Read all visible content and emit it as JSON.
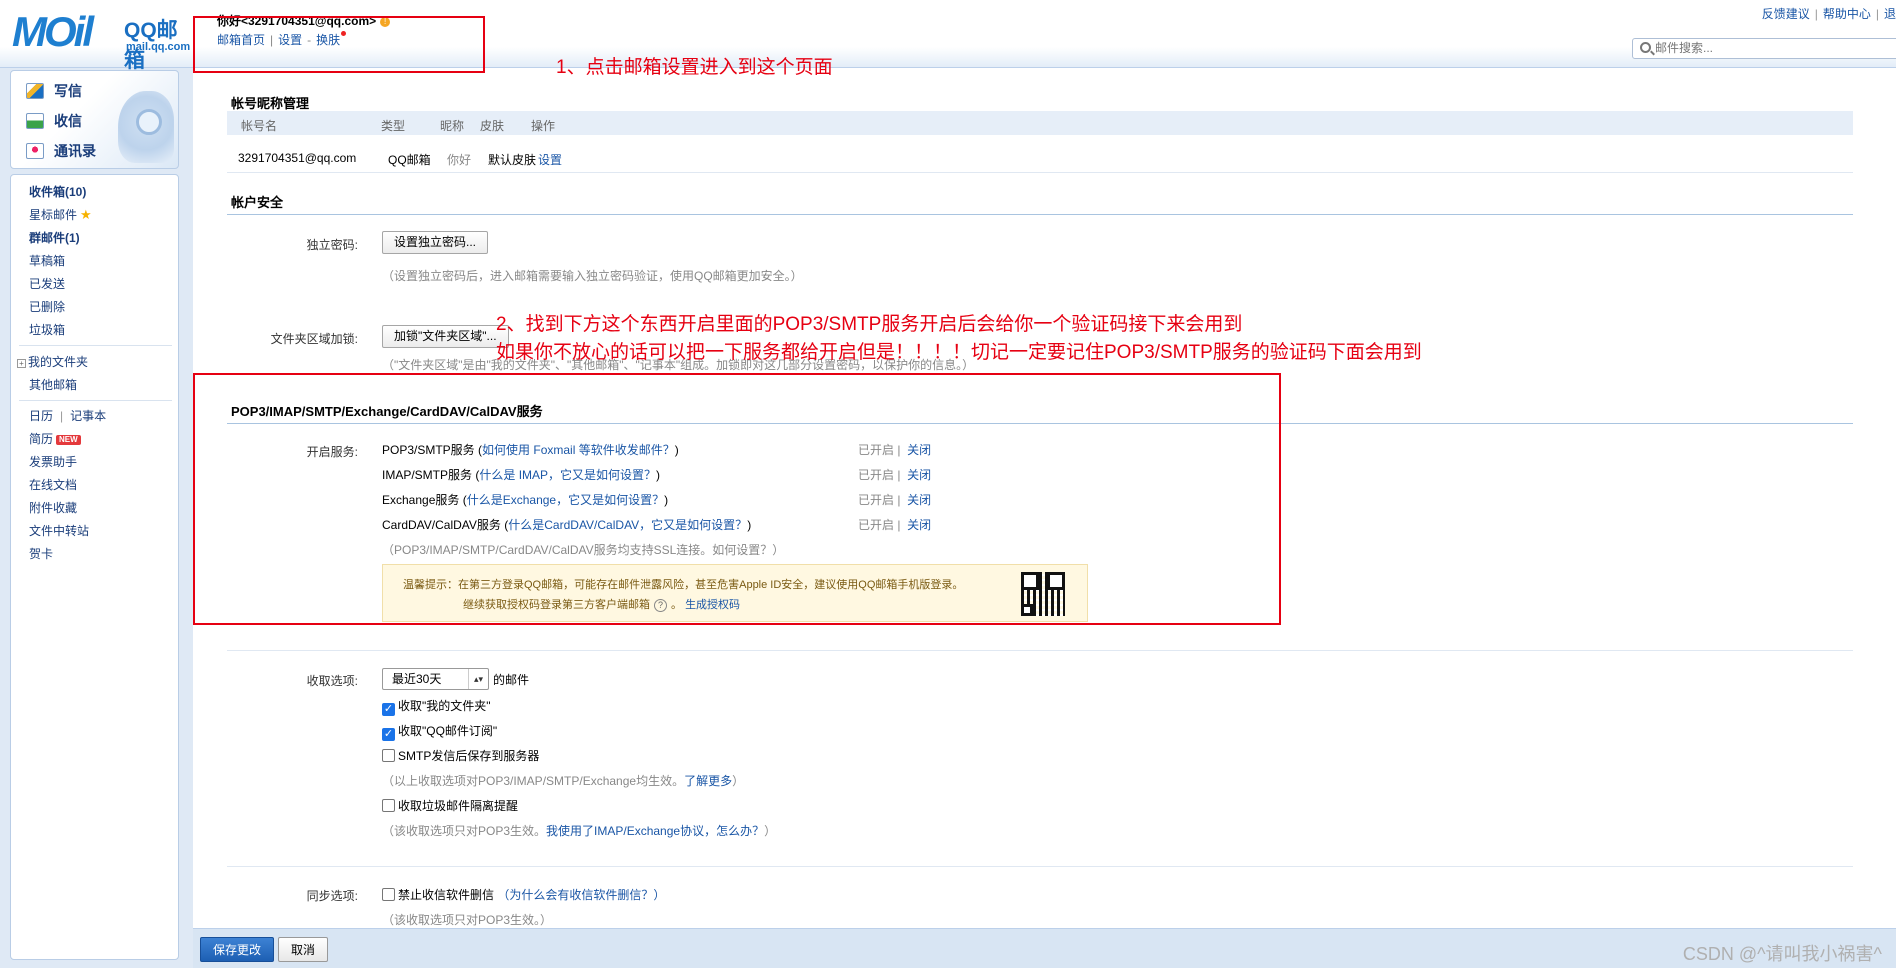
{
  "header": {
    "logo_mail": "MOil",
    "logo_qq": "QQ邮箱",
    "logo_domain": "mail.qq.com",
    "greeting": "你好<3291704351@qq.com>",
    "links": [
      "邮箱首页",
      "设置",
      "换肤"
    ],
    "right_links": [
      "反馈建议",
      "帮助中心",
      "退"
    ],
    "search_placeholder": "邮件搜索..."
  },
  "sidebar": {
    "actions": [
      "写信",
      "收信",
      "通讯录"
    ],
    "folders": [
      {
        "label": "收件箱(10)",
        "bold": true
      },
      {
        "label": "星标邮件",
        "bold": false
      },
      {
        "label": "群邮件(1)",
        "bold": true
      },
      {
        "label": "草稿箱",
        "bold": false
      },
      {
        "label": "已发送",
        "bold": false
      },
      {
        "label": "已删除",
        "bold": false
      },
      {
        "label": "垃圾箱",
        "bold": false
      }
    ],
    "my_folders": "我的文件夹",
    "other_mail": "其他邮箱",
    "calendar": "日历",
    "notepad": "记事本",
    "resume": "简历",
    "new_badge": "NEW",
    "tools": [
      "发票助手",
      "在线文档",
      "附件收藏",
      "文件中转站",
      "贺卡"
    ]
  },
  "account": {
    "title": "帐号昵称管理",
    "headers": [
      "帐号名",
      "类型",
      "昵称",
      "皮肤",
      "操作"
    ],
    "row": [
      "3291704351@qq.com",
      "QQ邮箱",
      "你好",
      "默认皮肤",
      "设置"
    ]
  },
  "security": {
    "title": "帐户安全",
    "pwd_label": "独立密码:",
    "pwd_button": "设置独立密码...",
    "pwd_hint": "（设置独立密码后，进入邮箱需要输入独立密码验证，使用QQ邮箱更加安全。）",
    "folder_label": "文件夹区域加锁:",
    "folder_button": "加锁\"文件夹区域\"...",
    "folder_hint": "（\"文件夹区域\"是由\"我的文件夹\"、\"其他邮箱\"、\"记事本\"组成。加锁即对这几部分设置密码，以保护你的信息。）"
  },
  "services": {
    "title": "POP3/IMAP/SMTP/Exchange/CardDAV/CalDAV服务",
    "label": "开启服务:",
    "items": [
      {
        "name": "POP3/SMTP服务",
        "help": "如何使用 Foxmail 等软件收发邮件？"
      },
      {
        "name": "IMAP/SMTP服务",
        "help": "什么是 IMAP，它又是如何设置？"
      },
      {
        "name": "Exchange服务",
        "help": "什么是Exchange，它又是如何设置？"
      },
      {
        "name": "CardDAV/CalDAV服务",
        "help": "什么是CardDAV/CalDAV，它又是如何设置？"
      }
    ],
    "status": "已开启",
    "close": "关闭",
    "ssl_hint": "（POP3/IMAP/SMTP/CardDAV/CalDAV服务均支持SSL连接。如何设置？）",
    "tip_line1": "温馨提示：在第三方登录QQ邮箱，可能存在邮件泄露风险，甚至危害Apple ID安全，建议使用QQ邮箱手机版登录。",
    "tip_line2": "继续获取授权码登录第三方客户端邮箱",
    "tip_link": "生成授权码"
  },
  "receive": {
    "label": "收取选项:",
    "select_value": "最近30天",
    "select_suffix": "的邮件",
    "checks": [
      {
        "label": "收取\"我的文件夹\"",
        "checked": true
      },
      {
        "label": "收取\"QQ邮件订阅\"",
        "checked": true
      },
      {
        "label": "SMTP发信后保存到服务器",
        "checked": false
      }
    ],
    "hint1": "（以上收取选项对POP3/IMAP/SMTP/Exchange均生效。",
    "hint1_link": "了解更多",
    "hint1_end": "）",
    "check4": "收取垃圾邮件隔离提醒",
    "hint2": "（该收取选项只对POP3生效。",
    "hint2_link": "我使用了IMAP/Exchange协议，怎么办？",
    "hint2_end": "）"
  },
  "sync": {
    "label": "同步选项:",
    "check": "禁止收信软件删信",
    "help": "（为什么会有收信软件删信？）",
    "hint": "（该收取选项只对POP3生效。）"
  },
  "footer": {
    "save": "保存更改",
    "cancel": "取消",
    "watermark": "CSDN @^请叫我小祸害^"
  },
  "annotations": {
    "step1": "1、点击邮箱设置进入到这个页面",
    "step2_line1": "2、找到下方这个东西开启里面的POP3/SMTP服务开启后会给你一个验证码接下来会用到",
    "step2_line2": "如果你不放心的话可以把一下服务都给开启但是！！！！切记一定要记住POP3/SMTP服务的验证码下面会用到"
  },
  "colors": {
    "accent": "#1a56a6",
    "annotation": "#e60012",
    "save_button": "#2a6fc4"
  }
}
